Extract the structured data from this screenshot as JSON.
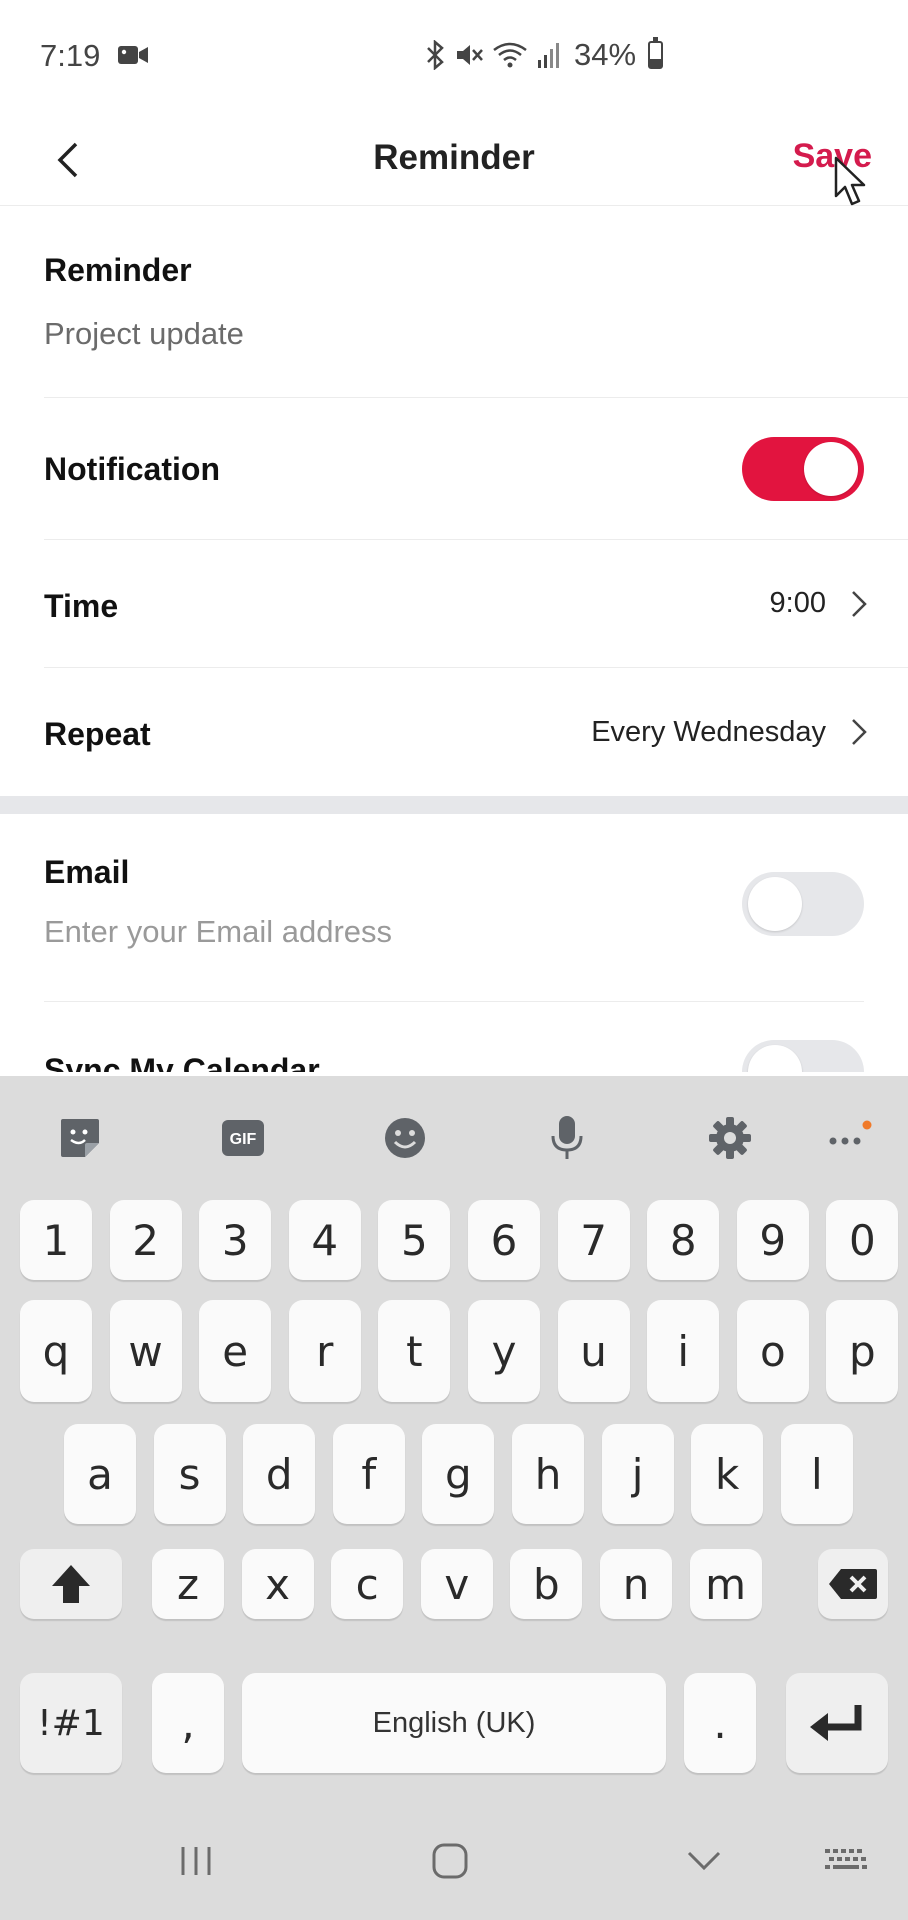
{
  "status_bar": {
    "time": "7:19",
    "battery": "34%",
    "battery_level": 0.34
  },
  "header": {
    "title": "Reminder",
    "save_label": "Save"
  },
  "form": {
    "reminder": {
      "label": "Reminder",
      "value": "Project update"
    },
    "notification": {
      "label": "Notification",
      "enabled": true
    },
    "time": {
      "label": "Time",
      "value": "9:00"
    },
    "repeat": {
      "label": "Repeat",
      "value": "Every Wednesday"
    },
    "email": {
      "label": "Email",
      "placeholder": "Enter your Email address",
      "enabled": false
    },
    "sync_calendar": {
      "label": "Sync My Calendar",
      "enabled": false
    }
  },
  "keyboard": {
    "toolbar": [
      "sticker-icon",
      "gif-icon",
      "emoji-icon",
      "microphone-icon",
      "settings-gear-icon",
      "more-options-icon"
    ],
    "gif_label": "GIF",
    "number_row": [
      "1",
      "2",
      "3",
      "4",
      "5",
      "6",
      "7",
      "8",
      "9",
      "0"
    ],
    "row1": [
      "q",
      "w",
      "e",
      "r",
      "t",
      "y",
      "u",
      "i",
      "o",
      "p"
    ],
    "row2": [
      "a",
      "s",
      "d",
      "f",
      "g",
      "h",
      "j",
      "k",
      "l"
    ],
    "row3": [
      "z",
      "x",
      "c",
      "v",
      "b",
      "n",
      "m"
    ],
    "symbols_label": "!#1",
    "comma_label": ",",
    "space_label": "English (UK)",
    "period_label": "."
  },
  "colors": {
    "accent": "#e2143f",
    "save_text": "#d41b4d",
    "keyboard_bg": "#dcdcdc"
  }
}
